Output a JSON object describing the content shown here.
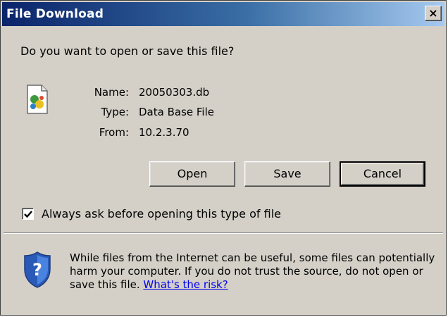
{
  "window": {
    "title": "File Download",
    "close_label": "×"
  },
  "prompt": {
    "question": "Do you want to open or save this file?"
  },
  "file": {
    "icon": "database-file-icon",
    "name_label": "Name:",
    "name_value": "20050303.db",
    "type_label": "Type:",
    "type_value": "Data Base File",
    "from_label": "From:",
    "from_value": "10.2.3.70"
  },
  "buttons": {
    "open": "Open",
    "save": "Save",
    "cancel": "Cancel"
  },
  "option": {
    "checked": true,
    "label": "Always ask before opening this type of file"
  },
  "warning": {
    "icon": "security-shield-icon",
    "text_before": "While files from the Internet can be useful, some files can potentially harm your computer. If you do not trust the source, do not open or save this file. ",
    "link": "What's the risk?"
  },
  "colors": {
    "dialog_bg": "#d4d0c8",
    "titlebar_start": "#0a246a",
    "titlebar_end": "#a6caf0",
    "link": "#0000ee"
  }
}
